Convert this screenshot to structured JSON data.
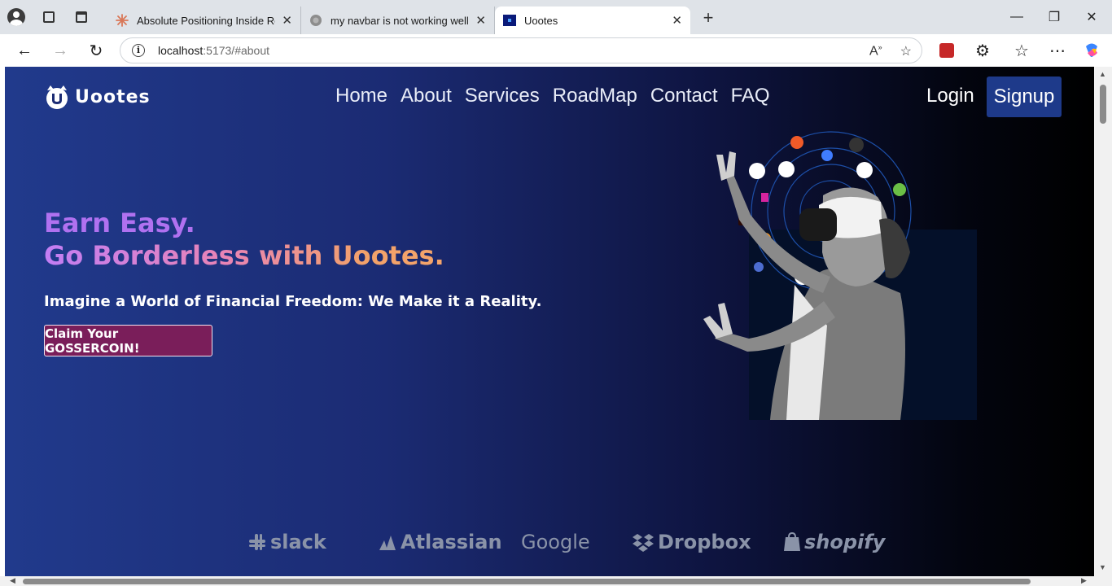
{
  "browser": {
    "tabs": [
      {
        "title": "Absolute Positioning Inside Relati",
        "favicon": "claude-icon",
        "active": false
      },
      {
        "title": "my navbar is not working well on",
        "favicon": "globe-icon",
        "active": false
      },
      {
        "title": "Uootes",
        "favicon": "uootes-icon",
        "active": true
      }
    ],
    "new_tab": "+",
    "address": {
      "host": "localhost",
      "rest": ":5173/#about"
    },
    "controls": {
      "minimize": "—",
      "restore": "❐",
      "close": "✕"
    }
  },
  "page": {
    "brand": "Uootes",
    "nav": [
      "Home",
      "About",
      "Services",
      "RoadMap",
      "Contact",
      "FAQ"
    ],
    "login": "Login",
    "signup": "Signup",
    "headline_1": "Earn Easy.",
    "headline_2": "Go Borderless with Uootes.",
    "subheadline": "Imagine a World of Financial Freedom: We Make it a Reality.",
    "cta": "Claim Your GOSSERCOIN!",
    "partners": [
      "slack",
      "Atlassian",
      "Google",
      "Dropbox",
      "shopify"
    ],
    "colors": {
      "cta": "#7a1e5a",
      "signup": "#1e3a8a",
      "bg_start": "#213a8c",
      "bg_end": "#000000"
    }
  }
}
